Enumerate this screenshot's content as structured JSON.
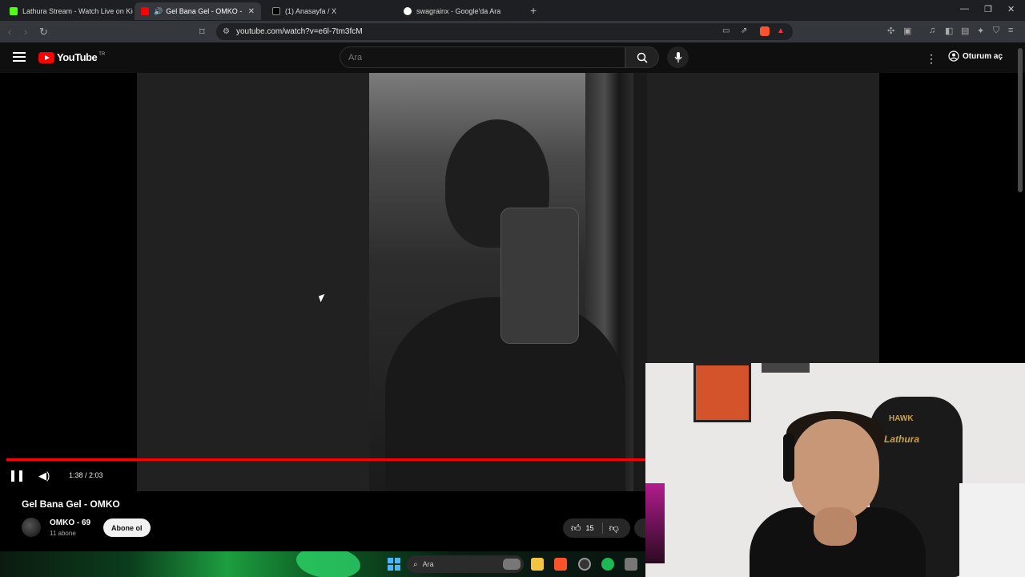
{
  "browser": {
    "tabs": [
      {
        "title": "Lathura Stream - Watch Live on Kick"
      },
      {
        "title": "Gel Bana Gel - OMKO - YouTu"
      },
      {
        "title": "(1) Anasayfa / X"
      },
      {
        "title": "swagrainx - Google'da Ara"
      }
    ],
    "new_tab": "+",
    "url": "youtube.com/watch?v=e6l-7tm3fcM"
  },
  "youtube": {
    "logo_text": "YouTube",
    "country_code": "TR",
    "search_placeholder": "Ara",
    "sign_in_label": "Oturum aç"
  },
  "player": {
    "time_display": "1:38 / 2:03",
    "progress": 0.797
  },
  "video": {
    "title": "Gel Bana Gel - OMKO",
    "channel_name": "OMKO - 69",
    "subscriber_count": "11 abone",
    "subscribe_label": "Abone ol",
    "like_count": "15"
  },
  "taskbar": {
    "search_label": "Ara"
  },
  "webcam": {
    "chair_brand": "HAWK",
    "chair_name": "Lathura"
  }
}
